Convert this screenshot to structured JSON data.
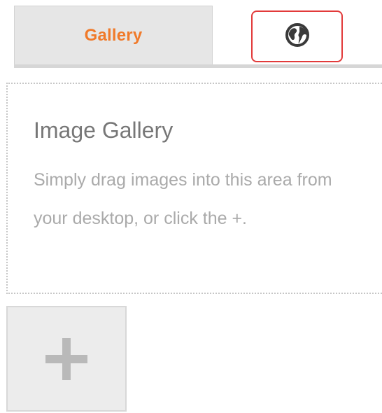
{
  "tabs": {
    "gallery_label": "Gallery",
    "web_icon": "globe-icon",
    "active_color": "#f07a2a",
    "selected_outline_color": "#e23a3a"
  },
  "dropzone": {
    "title": "Image Gallery",
    "text": "Simply drag images into this area from your desktop, or click the +."
  },
  "add_button": {
    "icon": "plus-icon"
  }
}
